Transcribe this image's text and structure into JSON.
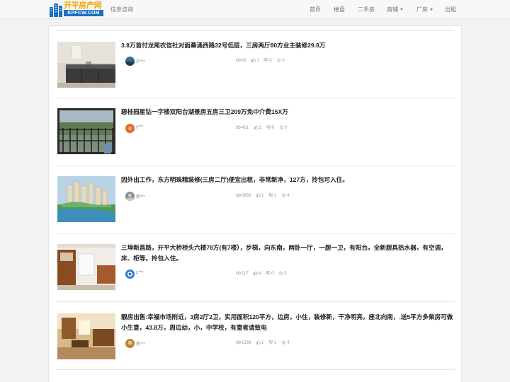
{
  "nav": {
    "logo_cn": "开平房产网",
    "logo_en": "KPFCW.COM",
    "info": "信息咨询",
    "links": [
      {
        "label": "首页",
        "dropdown": false
      },
      {
        "label": "楼盘",
        "dropdown": false
      },
      {
        "label": "二手房",
        "dropdown": false
      },
      {
        "label": "商铺",
        "dropdown": true
      },
      {
        "label": "厂房",
        "dropdown": true
      },
      {
        "label": "出租",
        "dropdown": false
      }
    ]
  },
  "listings": [
    {
      "title": "3.8万首付龙尾农信社对面幕涌西路32号低层，三房两厅80方业主装修29.8万",
      "user": "沪***",
      "views": "60",
      "likes": "1",
      "dislikes": "0",
      "favorites": "0"
    },
    {
      "title": "碧桂园星钻一字楼双阳台湖景房五房三卫209万免中介费15X万",
      "user": "y***",
      "views": "401",
      "likes": "2",
      "dislikes": "0",
      "favorites": "0"
    },
    {
      "title": "因外出工作，东方明珠精装修(三房二厅)便宜出租，非常新净，127方，拎包可入住。",
      "user": "新***",
      "views": "3669",
      "likes": "2",
      "dislikes": "1",
      "favorites": "4"
    },
    {
      "title": "三埠新昌路，开平大桥桥头六楼78方(有7楼），步梯，向东南，两卧一厅，一厨一卫，有阳台。全新厨具热水器，有空调，床、柜等。拎包入住。",
      "user": "L***",
      "views": "117",
      "likes": "4",
      "dislikes": "0",
      "favorites": "0"
    },
    {
      "title": "靓房出售:幸福市场附近，3房2厅2卫，实用面积120平方，边房，小住，装修新，干净明亮，座北向南，.送5平方多柴房可做小生意，43.8万，周边幼，小，中学校，有意者请致电",
      "user": "热***",
      "views": "1339",
      "likes": "1",
      "dislikes": "1",
      "favorites": "4"
    }
  ]
}
